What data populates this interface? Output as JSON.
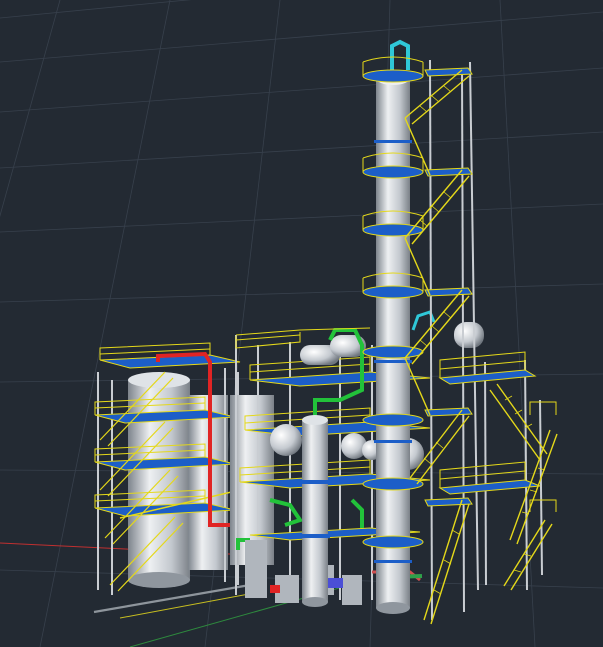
{
  "viewport": {
    "mode": "3D perspective",
    "background_color": "#232a33",
    "grid_color": "#3a434f"
  },
  "colors": {
    "steel": "#e4d81a",
    "deck": "#1c5ec8",
    "vessel": "#c8cdd3",
    "vessel_shadow": "#8f969e",
    "pipe_red": "#e02424",
    "pipe_green": "#22c23a",
    "pipe_cyan": "#2fc8d8",
    "axis_x": "#c03030",
    "axis_y": "#2e8a3e"
  },
  "icons": {
    "model": "process-plant-3d-model",
    "column": "distillation-column-icon",
    "ucs": "ucs-axis-icon"
  }
}
